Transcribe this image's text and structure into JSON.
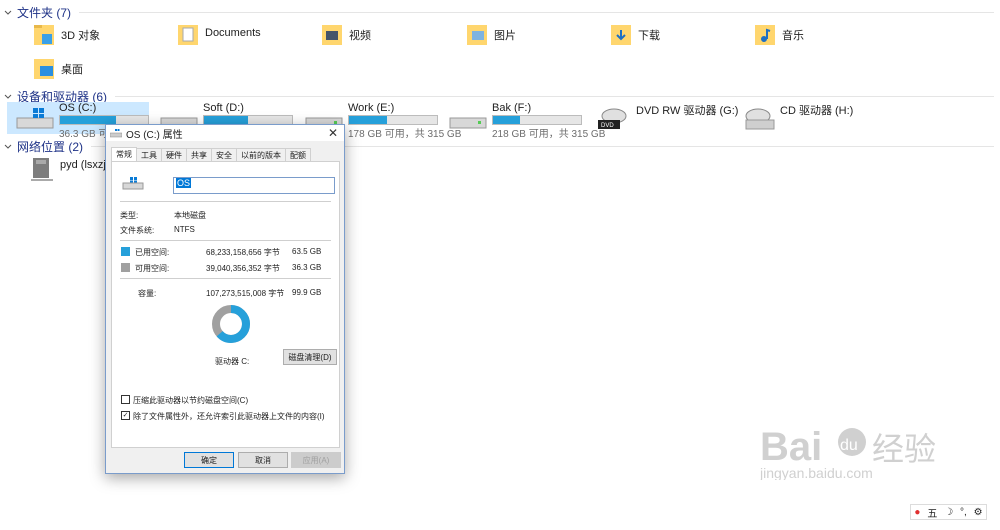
{
  "sections": {
    "folders": "文件夹 (7)",
    "devices": "设备和驱动器 (6)",
    "network": "网络位置 (2)"
  },
  "folders": [
    "3D 对象",
    "Documents",
    "视频",
    "图片",
    "下载",
    "音乐",
    "桌面"
  ],
  "drives": [
    {
      "name": "OS (C:)",
      "free": "36.3 GB 可用",
      "used_fraction": 0.64
    },
    {
      "name": "Soft (D:)",
      "free": "",
      "used_fraction": 0.5
    },
    {
      "name": "Work (E:)",
      "free": "178 GB 可用，共 315 GB",
      "used_fraction": 0.43
    },
    {
      "name": "Bak (F:)",
      "free": "218 GB 可用，共 315 GB",
      "used_fraction": 0.31
    },
    {
      "name": "DVD RW 驱动器 (G:)",
      "free": ""
    },
    {
      "name": "CD 驱动器 (H:)",
      "free": ""
    }
  ],
  "network": [
    "pyd (lsxzj)"
  ],
  "dialog": {
    "title": "OS (C:) 属性",
    "tabs": [
      "常规",
      "工具",
      "硬件",
      "共享",
      "安全",
      "以前的版本",
      "配额"
    ],
    "name_value": "OS",
    "type_label": "类型:",
    "type_value": "本地磁盘",
    "fs_label": "文件系统:",
    "fs_value": "NTFS",
    "used_label": "已用空间:",
    "used_bytes": "68,233,158,656 字节",
    "used_gb": "63.5 GB",
    "free_label": "可用空间:",
    "free_bytes": "39,040,356,352 字节",
    "free_gb": "36.3 GB",
    "cap_label": "容量:",
    "cap_bytes": "107,273,515,008 字节",
    "cap_gb": "99.9 GB",
    "used_fraction": 0.636,
    "drive_label": "驱动器 C:",
    "cleanup": "磁盘清理(D)",
    "compress": "压缩此驱动器以节约磁盘空间(C)",
    "index": "除了文件属性外，还允许索引此驱动器上文件的内容(I)",
    "ok": "确定",
    "cancel": "取消",
    "apply": "应用(A)"
  },
  "watermark": {
    "line1": "Bai",
    "line2": "jingyan.baidu.com",
    "brand": "经验",
    "brand2": "du"
  },
  "tray": [
    "五",
    "⚙"
  ],
  "colors": {
    "accent": "#26a0da",
    "header": "#1e3287",
    "free_swatch": "#a0a0a0",
    "used_swatch": "#26a0da"
  }
}
